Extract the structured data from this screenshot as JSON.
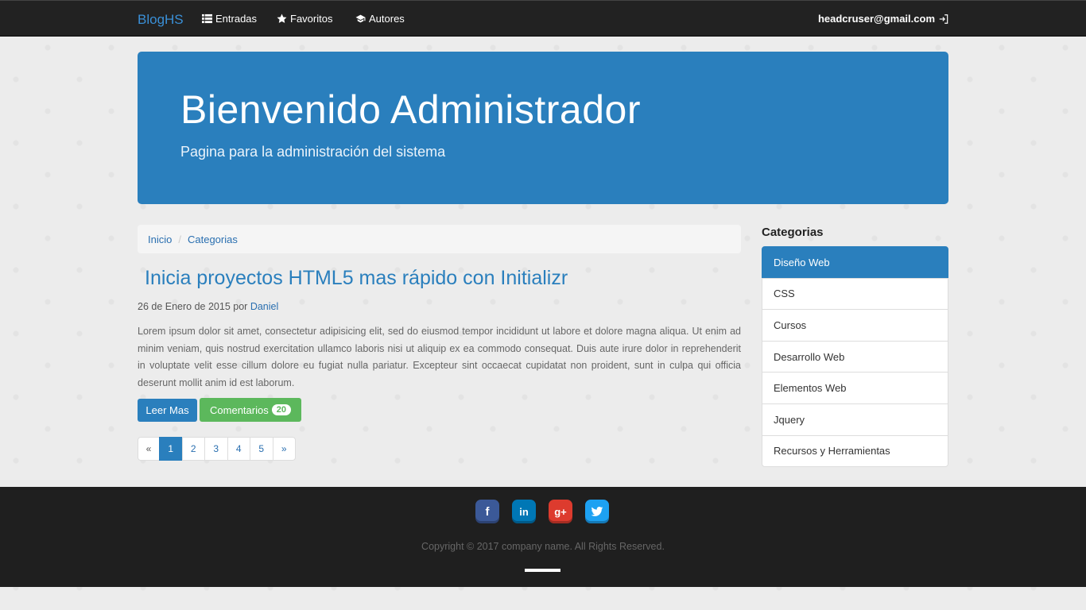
{
  "navbar": {
    "brand": "BlogHS",
    "items": [
      {
        "label": "Entradas",
        "icon": "list-icon"
      },
      {
        "label": "Favoritos",
        "icon": "star-icon"
      },
      {
        "label": "Autores",
        "icon": "graduation-cap-icon"
      }
    ],
    "user_email": "headcruser@gmail.com"
  },
  "jumbotron": {
    "title": "Bienvenido Administrador",
    "subtitle": "Pagina para la administración del sistema"
  },
  "breadcrumb": [
    "Inicio",
    "Categorias"
  ],
  "post": {
    "title": "Inicia proyectos HTML5 mas rápido con Initializr",
    "date": "26 de Enero de 2015",
    "by": "por",
    "author": "Daniel",
    "body": "Lorem ipsum dolor sit amet, consectetur adipisicing elit, sed do eiusmod tempor incididunt ut labore et dolore magna aliqua. Ut enim ad minim veniam, quis nostrud exercitation ullamco laboris nisi ut aliquip ex ea commodo consequat. Duis aute irure dolor in reprehenderit in voluptate velit esse cillum dolore eu fugiat nulla pariatur. Excepteur sint occaecat cupidatat non proident, sunt in culpa qui officia deserunt mollit anim id est laborum.",
    "read_more": "Leer Mas",
    "comments_label": "Comentarios",
    "comments_count": "20"
  },
  "pagination": {
    "prev": "«",
    "pages": [
      "1",
      "2",
      "3",
      "4",
      "5"
    ],
    "active": "1",
    "next": "»"
  },
  "sidebar": {
    "title": "Categorias",
    "categories": [
      "Diseño Web",
      "CSS",
      "Cursos",
      "Desarrollo Web",
      "Elementos Web",
      "Jquery",
      "Recursos y Herramientas"
    ],
    "active": "Diseño Web"
  },
  "footer": {
    "socials": [
      "facebook-icon",
      "linkedin-icon",
      "google-plus-icon",
      "twitter-icon"
    ],
    "copyright": "Copyright © 2017 company name. All Rights Reserved."
  },
  "colors": {
    "primary": "#2a7fbd",
    "success": "#5cb85c",
    "navbar": "#222222",
    "footer": "#1f1f1f"
  }
}
